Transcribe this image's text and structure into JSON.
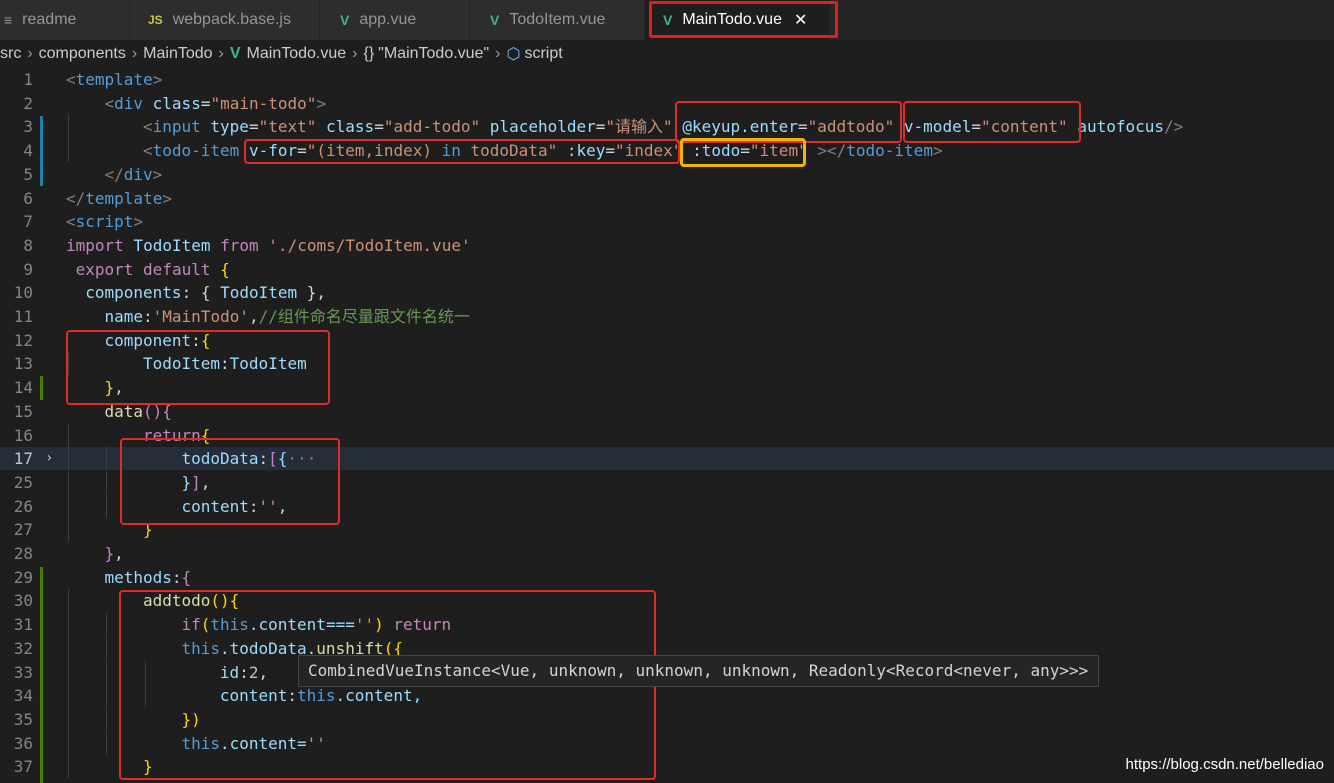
{
  "tabs": [
    {
      "label": "readme",
      "icon": "menu-icon"
    },
    {
      "label": "webpack.base.js",
      "icon": "js-icon"
    },
    {
      "label": "app.vue",
      "icon": "vue-icon"
    },
    {
      "label": "TodoItem.vue",
      "icon": "vue-icon"
    },
    {
      "label": "MainTodo.vue",
      "icon": "vue-icon",
      "active": true
    }
  ],
  "breadcrumb": {
    "p1": "src",
    "p2": "components",
    "p3": "MainTodo",
    "p4": "MainTodo.vue",
    "p5": "\"MainTodo.vue\"",
    "p6": "script"
  },
  "line_numbers": [
    "1",
    "2",
    "3",
    "4",
    "5",
    "6",
    "7",
    "8",
    "9",
    "10",
    "11",
    "12",
    "13",
    "14",
    "15",
    "16",
    "17",
    "25",
    "26",
    "27",
    "28",
    "29",
    "30",
    "31",
    "32",
    "33",
    "34",
    "35",
    "36",
    "37"
  ],
  "code": {
    "l1": [
      "<",
      "template",
      ">"
    ],
    "l2": [
      "<",
      "div",
      " ",
      "class",
      "=",
      "\"main-todo\"",
      ">"
    ],
    "l3": [
      "<",
      "input",
      " ",
      "type",
      "=",
      "\"text\"",
      " ",
      "class",
      "=",
      "\"add-todo\"",
      " ",
      "placeholder",
      "=",
      "\"请输入\"",
      " ",
      "@keyup.enter",
      "=",
      "\"addtodo\"",
      " ",
      "v-model",
      "=",
      "\"content\"",
      " ",
      "autofocus",
      "/>"
    ],
    "l4": [
      "<",
      "todo-item",
      " ",
      "v-for",
      "=",
      "\"(item,index) ",
      "in",
      " todoData\"",
      " ",
      ":key",
      "=",
      "\"index\"",
      " ",
      ":todo",
      "=",
      "\"item\"",
      " ",
      "></",
      "todo-item",
      ">"
    ],
    "l5": [
      "</",
      "div",
      ">"
    ],
    "l6": [
      "</",
      "template",
      ">"
    ],
    "l7": [
      "<",
      "script",
      ">"
    ],
    "l8": [
      "import",
      " TodoItem ",
      "from",
      " ",
      "'./coms/TodoItem.vue'"
    ],
    "l9": [
      "export",
      " ",
      "default",
      " ",
      "{"
    ],
    "l10": [
      "components",
      ": { ",
      "TodoItem",
      " },"
    ],
    "l11": [
      "name",
      ":",
      "'MainTodo'",
      ",",
      "//组件命名尽量跟文件名统一"
    ],
    "l12": [
      "component",
      ":",
      "{"
    ],
    "l13": [
      "TodoItem",
      ":",
      "TodoItem"
    ],
    "l14": [
      "}",
      ","
    ],
    "l15": [
      "data",
      "(){"
    ],
    "l16": [
      "return",
      "{"
    ],
    "l17": [
      "todoData",
      ":",
      "[",
      "{",
      "···"
    ],
    "l25": [
      "}",
      "]",
      ","
    ],
    "l26": [
      "content",
      ":",
      "''",
      ","
    ],
    "l27": [
      "}"
    ],
    "l28": [
      "}",
      ","
    ],
    "l29": [
      "methods",
      ":",
      "{"
    ],
    "l30": [
      "addtodo",
      "(){"
    ],
    "l31": [
      "if",
      "(",
      "this",
      ".content===",
      "''",
      ") ",
      "return"
    ],
    "l32": [
      "this",
      ".todoData.",
      "unshift",
      "({"
    ],
    "l33": [
      "id",
      ":",
      "2",
      ","
    ],
    "l34": [
      "content",
      ":",
      "this",
      ".content,"
    ],
    "l35": [
      "})"
    ],
    "l36": [
      "this",
      ".content=",
      "''"
    ],
    "l37": [
      "}"
    ]
  },
  "hover_tooltip": "CombinedVueInstance<Vue, unknown, unknown, unknown, Readonly<Record<never, any>>>",
  "watermark": "https://blog.csdn.net/bellediao",
  "colors": {
    "annotation_red": "#e02b2b",
    "annotation_yellow": "#f5b400",
    "vue_green": "#41b883"
  }
}
